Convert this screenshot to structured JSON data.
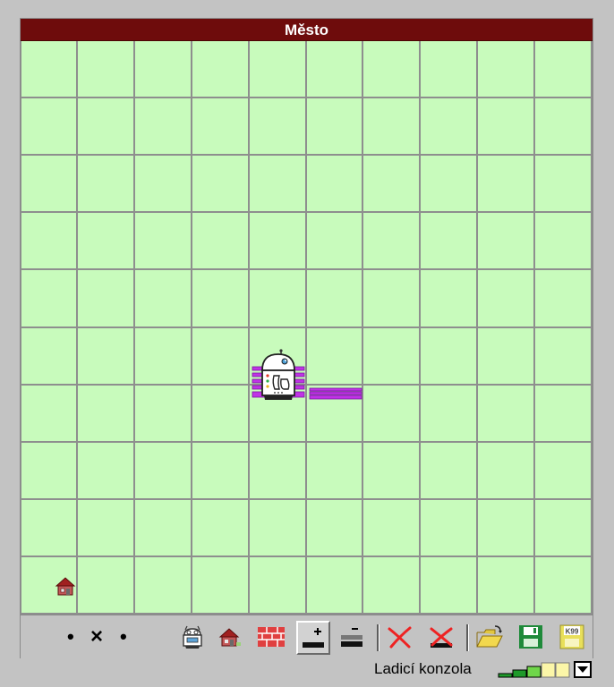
{
  "window": {
    "title": "Město"
  },
  "grid": {
    "rows": 10,
    "cols": 10
  },
  "objects": {
    "robot": {
      "icon": "robot-icon",
      "col": 4,
      "row": 5
    },
    "marks": [
      {
        "icon": "purple-mark",
        "col": 4,
        "row": 5,
        "count": 5
      },
      {
        "icon": "purple-mark",
        "col": 5,
        "row": 5,
        "count": 3
      }
    ],
    "home": {
      "icon": "house-icon",
      "col": 0,
      "row": 9
    }
  },
  "toolbar": {
    "speed_left": "•",
    "speed_stop": "×",
    "speed_right": "•",
    "tools": [
      {
        "name": "place-robot-button",
        "icon": "robot-icon"
      },
      {
        "name": "place-home-button",
        "icon": "house-icon"
      },
      {
        "name": "place-wall-button",
        "icon": "brick-wall-icon"
      },
      {
        "name": "add-mark-button",
        "icon": "add-mark-icon",
        "pressed": true
      },
      {
        "name": "remove-mark-button",
        "icon": "remove-mark-icon"
      },
      {
        "name": "delete-button",
        "icon": "red-x-icon"
      },
      {
        "name": "clear-marks-button",
        "icon": "clear-marks-icon"
      },
      {
        "name": "open-button",
        "icon": "open-folder-icon"
      },
      {
        "name": "save-button",
        "icon": "save-icon"
      },
      {
        "name": "save-k99-button",
        "icon": "k99-save-icon"
      }
    ],
    "save_k99_label": "K99"
  },
  "console": {
    "label": "Ladicí konzola",
    "level": 2,
    "levels": 5
  },
  "colors": {
    "grid_bg": "#c8fbbc",
    "grid_line": "#8e8e8e",
    "title_bg": "#6e0c0c",
    "mark": "#c033e6"
  }
}
